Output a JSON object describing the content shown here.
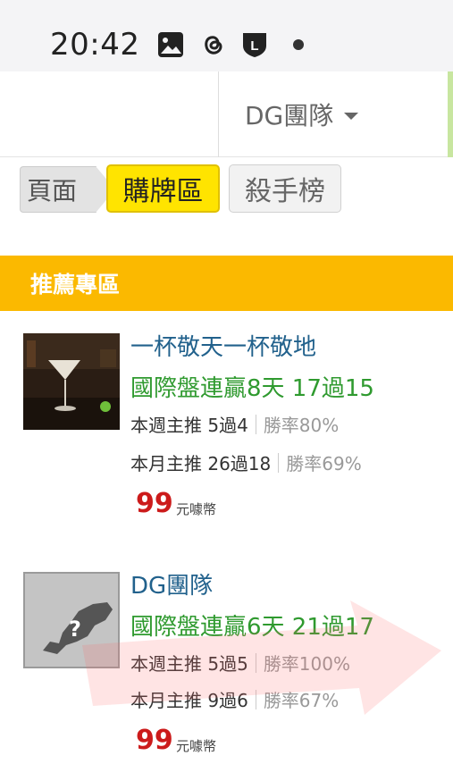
{
  "status_bar": {
    "time": "20:42",
    "icons": [
      "image-icon",
      "threads-icon",
      "line-shield-icon",
      "dot-icon"
    ],
    "line_badge_letter": "L"
  },
  "top_bar": {
    "team_dropdown_label": "DG團隊"
  },
  "tabs": {
    "breadcrumb": "頁面",
    "active": "購牌區",
    "other": "殺手榜"
  },
  "section": {
    "title": "推薦專區"
  },
  "cards": [
    {
      "name": "一杯敬天一杯敬地",
      "streak": "國際盤連贏8天 17過15",
      "week_label": "本週主推 5過4",
      "week_rate": "勝率80%",
      "month_label": "本月主推 26過18",
      "month_rate": "勝率69%",
      "price": "99",
      "price_unit": "元噱幣",
      "thumb": "martini-photo"
    },
    {
      "name": "DG團隊",
      "streak": "國際盤連贏6天 21過17",
      "week_label": "本週主推 5過5",
      "week_rate": "勝率100%",
      "month_label": "本月主推 9過6",
      "month_rate": "勝率67%",
      "price": "99",
      "price_unit": "元噱幣",
      "thumb": "unknown-avatar"
    }
  ],
  "colors": {
    "section_header": "#fbb900",
    "active_tab": "#ffe400",
    "name_link": "#21618c",
    "streak_green": "#2f9a2f",
    "price_red": "#cc1b1b"
  }
}
